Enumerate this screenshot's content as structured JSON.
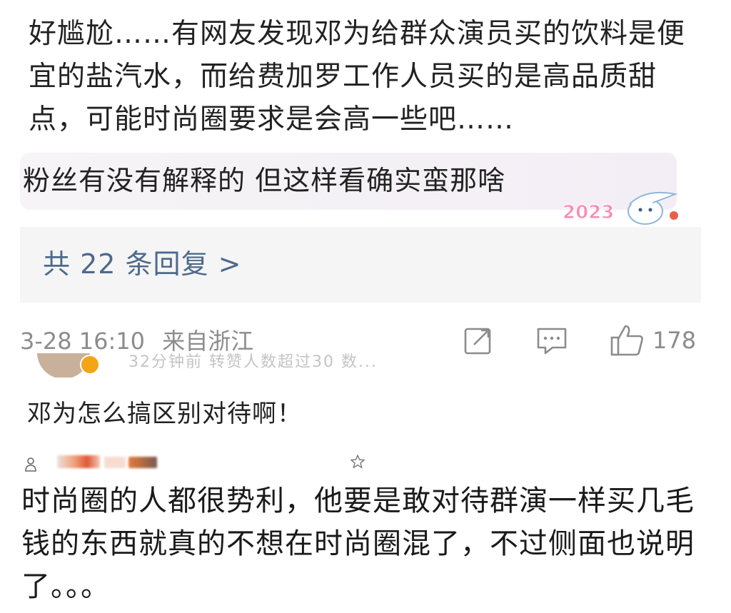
{
  "post": {
    "text": "好尴尬……有网友发现邓为给群众演员买的饮料是便宜的盐汽水，而给费加罗工作人员买的是高品质甜点，可能时尚圈要求是会高一些吧……"
  },
  "reply": {
    "text": "粉丝有没有解释的 但这样看确实蛮那啥",
    "sticker_text": "2023"
  },
  "reply_footer": {
    "label": "共 22 条回复 >"
  },
  "post_meta": {
    "time": "3-28 16:10",
    "source": "来自浙江",
    "likes": "178",
    "icons": [
      "share-icon",
      "comment-icon",
      "like-icon"
    ]
  },
  "faded_row": {
    "text": "32分钟前  转赞人数超过30  数..."
  },
  "comment2": {
    "text": "邓为怎么搞区别对待啊！"
  },
  "comment3": {
    "text": "时尚圈的人都很势利，他要是敢对待群演一样买几毛钱的东西就真的不想在时尚圈混了，不过侧面也说明了。。。"
  },
  "colors": {
    "link": "#4d6a8c",
    "meta": "#8c8c8c",
    "text": "#222222"
  }
}
